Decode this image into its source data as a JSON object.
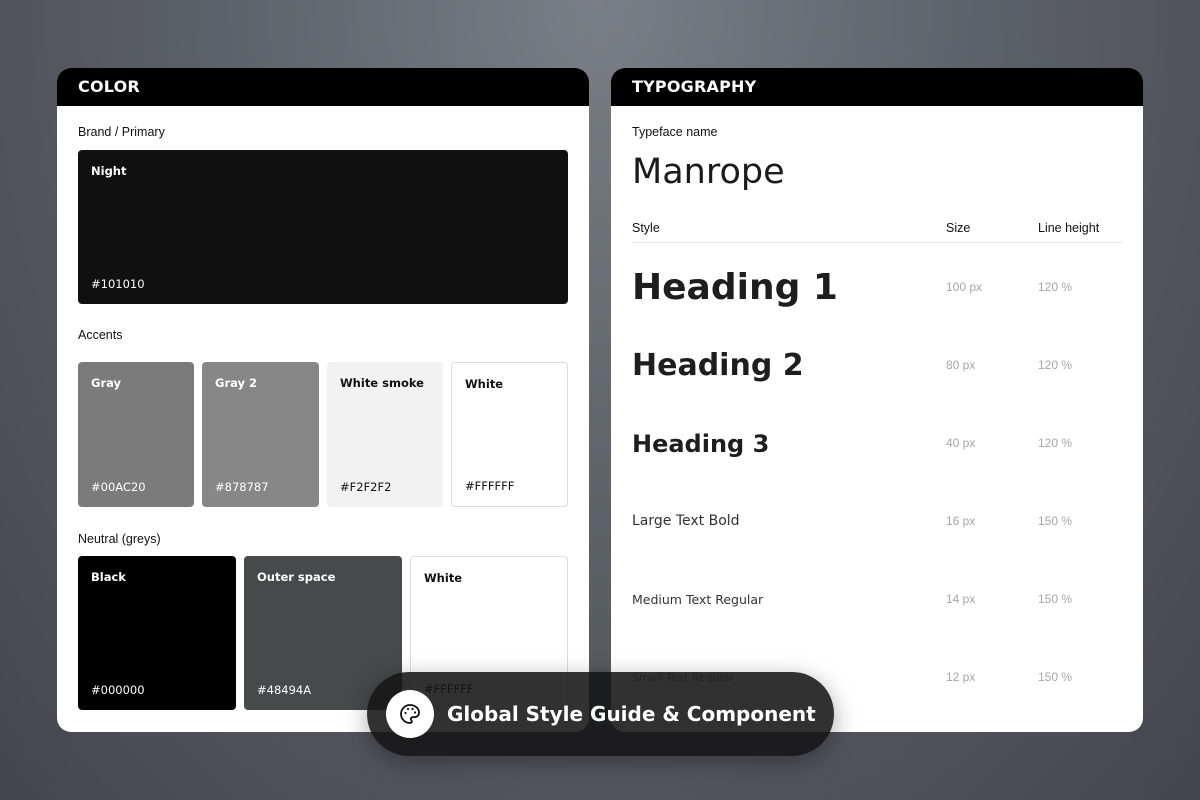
{
  "color_panel": {
    "title": "COLOR",
    "brand_label": "Brand / Primary",
    "brand": {
      "name": "Night",
      "hex": "#101010",
      "color": "#101010"
    },
    "accents_label": "Accents",
    "accents": [
      {
        "name": "Gray",
        "hex": "#00AC20",
        "color": "#7b7b7b"
      },
      {
        "name": "Gray 2",
        "hex": "#878787",
        "color": "#878787"
      },
      {
        "name": "White smoke",
        "hex": "#F2F2F2",
        "color": "#F2F2F2"
      },
      {
        "name": "White",
        "hex": "#FFFFFF",
        "color": "#FFFFFF"
      }
    ],
    "neutral_label": "Neutral (greys)",
    "neutrals": [
      {
        "name": "Black",
        "hex": "#000000",
        "color": "#000000"
      },
      {
        "name": "Outer space",
        "hex": "#48494A",
        "color": "#48494A"
      },
      {
        "name": "White",
        "hex": "#FFFFFF",
        "color": "#FFFFFF"
      }
    ]
  },
  "typography_panel": {
    "title": "TYPOGRAPHY",
    "typeface_label": "Typeface name",
    "typeface": "Manrope",
    "columns": {
      "style": "Style",
      "size": "Size",
      "line_height": "Line height"
    },
    "rows": [
      {
        "style": "Heading 1",
        "size": "100 px",
        "line_height": "120 %"
      },
      {
        "style": "Heading 2",
        "size": "80 px",
        "line_height": "120 %"
      },
      {
        "style": "Heading 3",
        "size": "40 px",
        "line_height": "120 %"
      },
      {
        "style": "Large Text Bold",
        "size": "16 px",
        "line_height": "150 %"
      },
      {
        "style": "Medium Text Regular",
        "size": "14 px",
        "line_height": "150 %"
      },
      {
        "style": "Small Text Regular",
        "size": "12 px",
        "line_height": "150 %"
      }
    ]
  },
  "banner": {
    "icon": "palette-icon",
    "text": "Global Style Guide & Component"
  }
}
